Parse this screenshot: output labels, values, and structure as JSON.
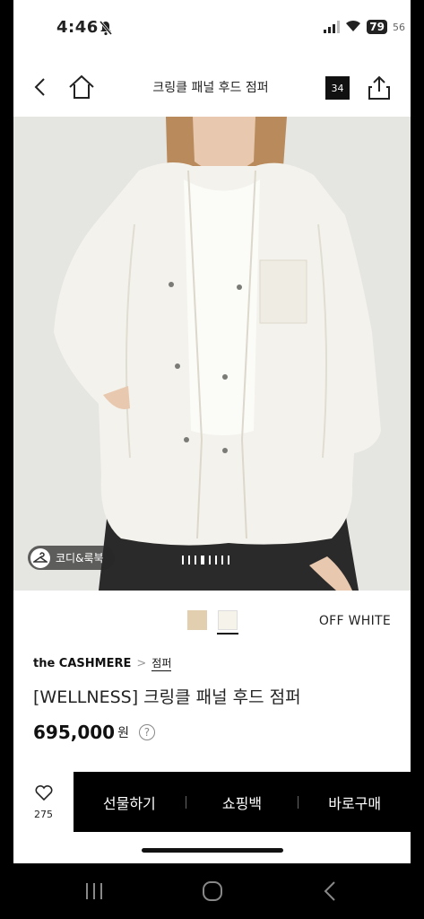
{
  "status_bar": {
    "time": "4:46",
    "battery": "79",
    "extra": "56",
    "icons": [
      "mute-icon",
      "signal-icon",
      "wifi-icon",
      "battery-icon"
    ]
  },
  "header": {
    "title": "크링클 패널 후드 점퍼",
    "cart_count": "34",
    "icons": [
      "back-icon",
      "home-icon",
      "share-icon"
    ]
  },
  "gallery": {
    "coordi_label": "코디&룩북",
    "page_count": 8,
    "current_page": 4
  },
  "colors": {
    "swatches": [
      {
        "name": "beige",
        "hex": "#e2cfb0"
      },
      {
        "name": "off-white",
        "hex": "#f6f3ea",
        "selected": true
      }
    ],
    "selected_name": "OFF WHITE"
  },
  "product": {
    "brand": "the CASHMERE",
    "category": "점퍼",
    "name": "[WELLNESS] 크링클 패널 후드 점퍼",
    "price": "695,000",
    "currency": "원",
    "help": "?"
  },
  "action_bar": {
    "like_count": "275",
    "gift_label": "선물하기",
    "bag_label": "쇼핑백",
    "buy_label": "바로구매"
  },
  "system_nav": {
    "icons": [
      "recent-apps-icon",
      "home-icon",
      "back-icon"
    ]
  }
}
